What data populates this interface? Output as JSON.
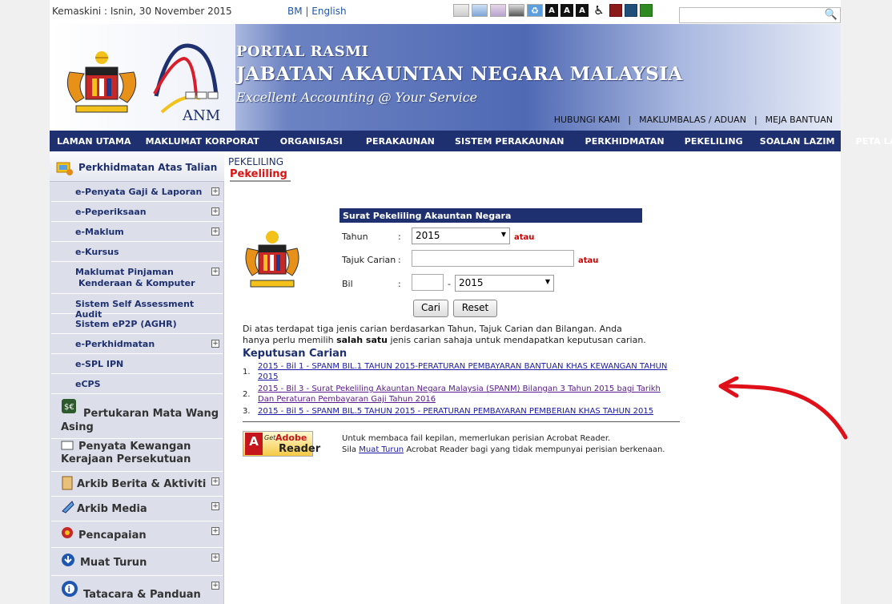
{
  "topbar": {
    "updated": "Kemaskini : Isnin, 30 November 2015",
    "lang_bm": "BM",
    "lang_sep": "|",
    "lang_en": "English",
    "tool_icons": [
      "text-size-icon",
      "sitemap-icon",
      "theme-icon",
      "contrast-icon",
      "accessibility-icon",
      "font-small-icon",
      "font-medium-icon",
      "font-large-icon",
      "wheelchair-icon"
    ],
    "font_letter": "A",
    "colors": [
      "#8b1a1a",
      "#1f4f7a",
      "#2e8b20"
    ]
  },
  "banner": {
    "line1": "PORTAL RASMI",
    "line2": "JABATAN AKAUNTAN NEGARA MALAYSIA",
    "line3": "Excellent Accounting @ Your Service",
    "anm": "ANM",
    "links": [
      "HUBUNGI KAMI",
      "MAKLUMBALAS / ADUAN",
      "MEJA BANTUAN"
    ]
  },
  "nav": [
    "LAMAN UTAMA",
    "MAKLUMAT KORPORAT",
    "ORGANISASI",
    "PERAKAUNAN",
    "SISTEM PERAKAUNAN",
    "PERKHIDMATAN",
    "PEKELILING",
    "SOALAN LAZIM",
    "PETA LAMAN"
  ],
  "sidebar": {
    "head": "Perkhidmatan Atas Talian",
    "subs": [
      {
        "label": "e-Penyata Gaji & Laporan",
        "plus": true
      },
      {
        "label": "e-Peperiksaan",
        "plus": true
      },
      {
        "label": "e-Maklum",
        "plus": true
      },
      {
        "label": "e-Kursus",
        "plus": false
      },
      {
        "label": "Maklumat Pinjaman",
        "label2": "Kenderaan & Komputer",
        "plus": true
      },
      {
        "label": "Sistem Self Assessment Audit",
        "plus": false
      },
      {
        "label": "Sistem eP2P (AGHR)",
        "plus": false
      },
      {
        "label": "e-Perkhidmatan",
        "plus": true
      },
      {
        "label": "e-SPL IPN",
        "plus": false
      },
      {
        "label": "eCPS",
        "plus": false
      }
    ],
    "mains": [
      {
        "label": "Pertukaran Mata Wang",
        "label2": "Asing"
      },
      {
        "label": "Penyata Kewangan",
        "label2": "Kerajaan Persekutuan"
      },
      {
        "label": "Arkib Berita & Aktiviti"
      },
      {
        "label": "Arkib Media"
      },
      {
        "label": "Pencapaian"
      },
      {
        "label": "Muat Turun"
      },
      {
        "label": "Tatacara & Panduan"
      }
    ],
    "plus_sign": "+"
  },
  "content": {
    "crumb": "PEKELILING",
    "title": "Pekeliling",
    "form_title": "Surat Pekeliling Akauntan Negara",
    "label_tahun": "Tahun",
    "label_tajuk": "Tajuk Carian",
    "label_bil": "Bil",
    "colon": ":",
    "tahun_value": "2015",
    "tajuk_value": "",
    "bil_value": "",
    "bil_dash": "-",
    "bil_year": "2015",
    "atau": "atau",
    "btn_cari": "Cari",
    "btn_reset": "Reset",
    "info_1": "Di atas terdapat tiga jenis carian berdasarkan Tahun, Tajuk Carian dan Bilangan. Anda hanya perlu memilih ",
    "info_bold": "salah satu",
    "info_2": " jenis carian sahaja untuk mendapatkan keputusan carian.",
    "results_title": "Keputusan Carian",
    "results": [
      {
        "num": "1.",
        "text": "2015 - Bil 1 - SPANM BIL.1 TAHUN 2015-PERATURAN PEMBAYARAN BANTUAN KHAS KEWANGAN TAHUN 2015"
      },
      {
        "num": "2.",
        "text": "2015 - Bil 3 - Surat Pekeliling Akauntan Negara Malaysia (SPANM) Bilangan 3 Tahun 2015 bagi Tarikh Dan Peraturan Pembayaran Gaji Tahun 2016"
      },
      {
        "num": "3.",
        "text": "2015 - Bil 5 - SPANM BIL.5 TAHUN 2015 - PERATURAN PEMBAYARAN PEMBERIAN KHAS TAHUN 2015"
      }
    ],
    "adobe_a": "A",
    "adobe_get": "Get",
    "adobe_brand": "Adobe",
    "adobe_reader": "Reader",
    "reader_line1": "Untuk membaca fail kepilan, memerlukan perisian Acrobat Reader.",
    "reader_line2a": "Sila ",
    "reader_link": "Muat Turun",
    "reader_line2b": " Acrobat Reader bagi yang tidak mempunyai perisian berkenaan."
  },
  "annotation_color": "#e0101a"
}
